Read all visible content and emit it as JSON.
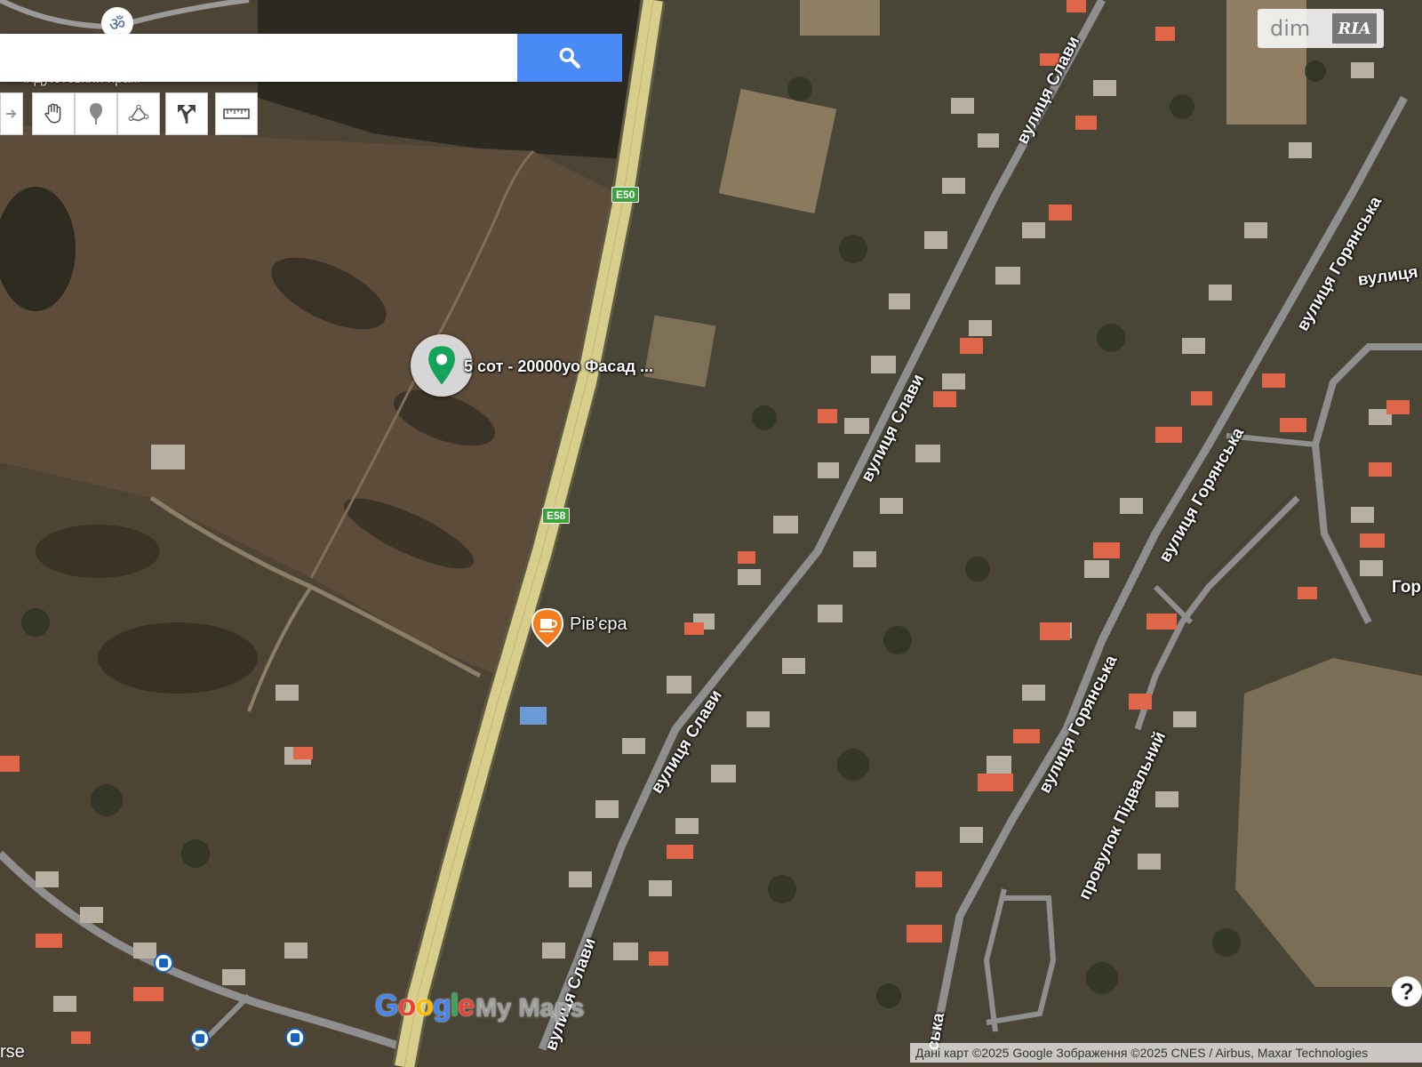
{
  "map": {
    "colors": {
      "ground": "#4a4336",
      "field_light": "#6b5a44",
      "highway": "#d8cf8a",
      "road": "#9a9a9a",
      "roof_red": "#e0664a",
      "accent_blue": "#4a8af4"
    },
    "highway_shields": [
      "E50",
      "E58"
    ],
    "street_labels": [
      {
        "id": "slavy-1",
        "text": "вулиця Слави"
      },
      {
        "id": "slavy-2",
        "text": "вулиця Слави"
      },
      {
        "id": "slavy-3",
        "text": "вулиця Слави"
      },
      {
        "id": "slavy-4",
        "text": "вулиця Слави"
      },
      {
        "id": "horianska-1",
        "text": "вулиця Горянська"
      },
      {
        "id": "horianska-2",
        "text": "вулиця Горянська"
      },
      {
        "id": "horianska-3",
        "text": "вулиця Горянська"
      },
      {
        "id": "pidvalnyi",
        "text": "провулок Підвальний"
      },
      {
        "id": "vulytsia-cut",
        "text": "вулиця"
      },
      {
        "id": "hor-cut",
        "text": "Гор"
      },
      {
        "id": "ska-cut",
        "text": "ська"
      }
    ],
    "poi": {
      "listing_label": "5 сот - 20000уо Фасад ...",
      "cafe_label": "Рів'єра",
      "temple_label": "індуїстський храм"
    },
    "search": {
      "placeholder": ""
    },
    "toolbar_icons": [
      "redo-icon",
      "hand-icon",
      "marker-icon",
      "line-icon",
      "directions-icon",
      "ruler-icon"
    ],
    "branding": {
      "dim_text": "dim",
      "ria_text": "RIA",
      "google_letters": [
        "G",
        "o",
        "o",
        "g",
        "l",
        "e"
      ],
      "my_maps": "My Maps"
    },
    "attribution": "Дані карт ©2025 Google Зображення ©2025 CNES / Airbus, Maxar Technologies",
    "left_cut_text": "rse"
  }
}
